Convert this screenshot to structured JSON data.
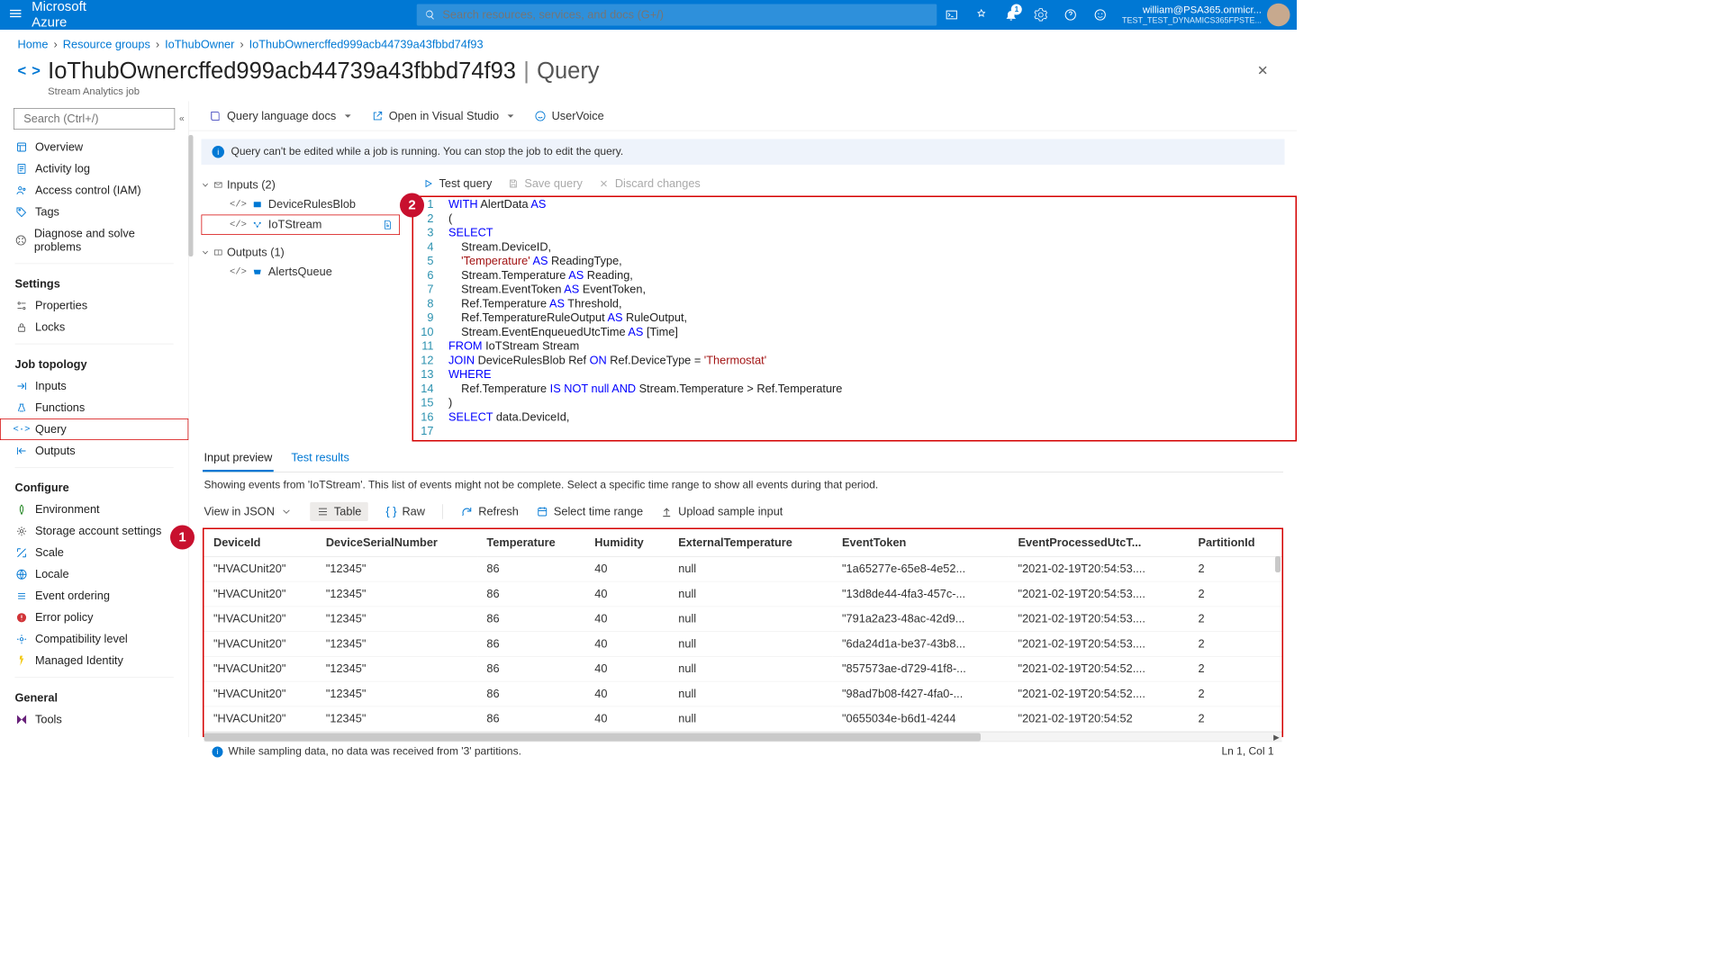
{
  "brand": "Microsoft Azure",
  "search": {
    "placeholder": "Search resources, services, and docs (G+/)"
  },
  "notif_count": "1",
  "user": {
    "email": "william@PSA365.onmicr...",
    "tenant": "TEST_TEST_DYNAMICS365FPSTE..."
  },
  "breadcrumb": [
    "Home",
    "Resource groups",
    "IoThubOwner",
    "IoThubOwnercffed999acb44739a43fbbd74f93"
  ],
  "page": {
    "chevrons": "< >",
    "title": "IoThubOwnercffed999acb44739a43fbbd74f93",
    "section": "Query",
    "subtitle": "Stream Analytics job"
  },
  "sidebar": {
    "search_placeholder": "Search (Ctrl+/)",
    "items_top": [
      "Overview",
      "Activity log",
      "Access control (IAM)",
      "Tags",
      "Diagnose and solve problems"
    ],
    "group_settings": "Settings",
    "items_settings": [
      "Properties",
      "Locks"
    ],
    "group_topology": "Job topology",
    "items_topology": [
      "Inputs",
      "Functions",
      "Query",
      "Outputs"
    ],
    "topology_active_index": 2,
    "group_configure": "Configure",
    "items_configure": [
      "Environment",
      "Storage account settings",
      "Scale",
      "Locale",
      "Event ordering",
      "Error policy",
      "Compatibility level",
      "Managed Identity"
    ],
    "group_general": "General",
    "items_general": [
      "Tools"
    ]
  },
  "toolbar": {
    "docs": "Query language docs",
    "open_vs": "Open in Visual Studio",
    "uservoice": "UserVoice"
  },
  "info_message": "Query can't be edited while a job is running. You can stop the job to edit the query.",
  "io": {
    "inputs_label": "Inputs (2)",
    "inputs": [
      "DeviceRulesBlob",
      "IoTStream"
    ],
    "inputs_highlight_index": 1,
    "outputs_label": "Outputs (1)",
    "outputs": [
      "AlertsQueue"
    ]
  },
  "editor_toolbar": {
    "test": "Test query",
    "save": "Save query",
    "discard": "Discard changes"
  },
  "code_lines": [
    [
      {
        "t": "WITH",
        "c": "kw"
      },
      {
        "t": " AlertData "
      },
      {
        "t": "AS",
        "c": "kw"
      }
    ],
    [
      {
        "t": "("
      }
    ],
    [
      {
        "t": "SELECT",
        "c": "kw"
      }
    ],
    [
      {
        "t": "    Stream.DeviceID,"
      }
    ],
    [
      {
        "t": "    "
      },
      {
        "t": "'Temperature'",
        "c": "str"
      },
      {
        "t": " "
      },
      {
        "t": "AS",
        "c": "kw"
      },
      {
        "t": " ReadingType,"
      }
    ],
    [
      {
        "t": "    Stream.Temperature "
      },
      {
        "t": "AS",
        "c": "kw"
      },
      {
        "t": " Reading,"
      }
    ],
    [
      {
        "t": "    Stream.EventToken "
      },
      {
        "t": "AS",
        "c": "kw"
      },
      {
        "t": " EventToken,"
      }
    ],
    [
      {
        "t": "    Ref.Temperature "
      },
      {
        "t": "AS",
        "c": "kw"
      },
      {
        "t": " Threshold,"
      }
    ],
    [
      {
        "t": "    Ref.TemperatureRuleOutput "
      },
      {
        "t": "AS",
        "c": "kw"
      },
      {
        "t": " RuleOutput,"
      }
    ],
    [
      {
        "t": "    Stream.EventEnqueuedUtcTime "
      },
      {
        "t": "AS",
        "c": "kw"
      },
      {
        "t": " [Time]"
      }
    ],
    [
      {
        "t": "FROM",
        "c": "kw"
      },
      {
        "t": " IoTStream Stream"
      }
    ],
    [
      {
        "t": "JOIN",
        "c": "kw"
      },
      {
        "t": " DeviceRulesBlob Ref "
      },
      {
        "t": "ON",
        "c": "kw"
      },
      {
        "t": " Ref.DeviceType = "
      },
      {
        "t": "'Thermostat'",
        "c": "str"
      }
    ],
    [
      {
        "t": "WHERE",
        "c": "kw"
      }
    ],
    [
      {
        "t": "    Ref.Temperature "
      },
      {
        "t": "IS",
        "c": "kw"
      },
      {
        "t": " "
      },
      {
        "t": "NOT",
        "c": "kw"
      },
      {
        "t": " "
      },
      {
        "t": "null",
        "c": "kw"
      },
      {
        "t": " "
      },
      {
        "t": "AND",
        "c": "kw"
      },
      {
        "t": " Stream.Temperature > Ref.Temperature"
      }
    ],
    [
      {
        "t": ")"
      }
    ],
    [
      {
        "t": ""
      }
    ],
    [
      {
        "t": "SELECT",
        "c": "kw"
      },
      {
        "t": " data.DeviceId,"
      }
    ]
  ],
  "results": {
    "tabs": [
      "Input preview",
      "Test results"
    ],
    "note": "Showing events from 'IoTStream'. This list of events might not be complete. Select a specific time range to show all events during that period.",
    "view": {
      "json": "View in JSON",
      "table": "Table",
      "raw": "Raw",
      "refresh": "Refresh",
      "range": "Select time range",
      "upload": "Upload sample input"
    },
    "columns": [
      "DeviceId",
      "DeviceSerialNumber",
      "Temperature",
      "Humidity",
      "ExternalTemperature",
      "EventToken",
      "EventProcessedUtcT...",
      "PartitionId"
    ],
    "rows": [
      [
        "\"HVACUnit20\"",
        "\"12345\"",
        "86",
        "40",
        "null",
        "\"1a65277e-65e8-4e52...",
        "\"2021-02-19T20:54:53....",
        "2"
      ],
      [
        "\"HVACUnit20\"",
        "\"12345\"",
        "86",
        "40",
        "null",
        "\"13d8de44-4fa3-457c-...",
        "\"2021-02-19T20:54:53....",
        "2"
      ],
      [
        "\"HVACUnit20\"",
        "\"12345\"",
        "86",
        "40",
        "null",
        "\"791a2a23-48ac-42d9...",
        "\"2021-02-19T20:54:53....",
        "2"
      ],
      [
        "\"HVACUnit20\"",
        "\"12345\"",
        "86",
        "40",
        "null",
        "\"6da24d1a-be37-43b8...",
        "\"2021-02-19T20:54:53....",
        "2"
      ],
      [
        "\"HVACUnit20\"",
        "\"12345\"",
        "86",
        "40",
        "null",
        "\"857573ae-d729-41f8-...",
        "\"2021-02-19T20:54:52....",
        "2"
      ],
      [
        "\"HVACUnit20\"",
        "\"12345\"",
        "86",
        "40",
        "null",
        "\"98ad7b08-f427-4fa0-...",
        "\"2021-02-19T20:54:52....",
        "2"
      ],
      [
        "\"HVACUnit20\"",
        "\"12345\"",
        "86",
        "40",
        "null",
        "\"0655034e-b6d1-4244",
        "\"2021-02-19T20:54:52",
        "2"
      ]
    ],
    "footer_msg": "While sampling data, no data was received from '3' partitions.",
    "cursor": "Ln 1, Col 1"
  },
  "callouts": {
    "editor": "2",
    "table": "1"
  }
}
